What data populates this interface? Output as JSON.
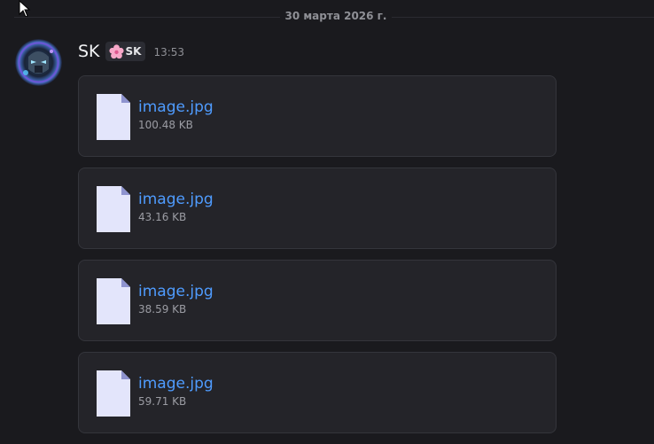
{
  "date_divider": "30 марта 2026 г.",
  "message": {
    "username": "SK",
    "tag": {
      "icon": "cherry-blossom-icon",
      "label": "SK"
    },
    "time": "13:53",
    "attachments": [
      {
        "name": "image.jpg",
        "size": "100.48 KB"
      },
      {
        "name": "image.jpg",
        "size": "43.16 KB"
      },
      {
        "name": "image.jpg",
        "size": "38.59 KB"
      },
      {
        "name": "image.jpg",
        "size": "59.71 KB"
      }
    ]
  },
  "colors": {
    "background": "#1a1a1e",
    "card": "#242429",
    "link": "#4f9cff",
    "file_icon": "#e3e5fb"
  }
}
